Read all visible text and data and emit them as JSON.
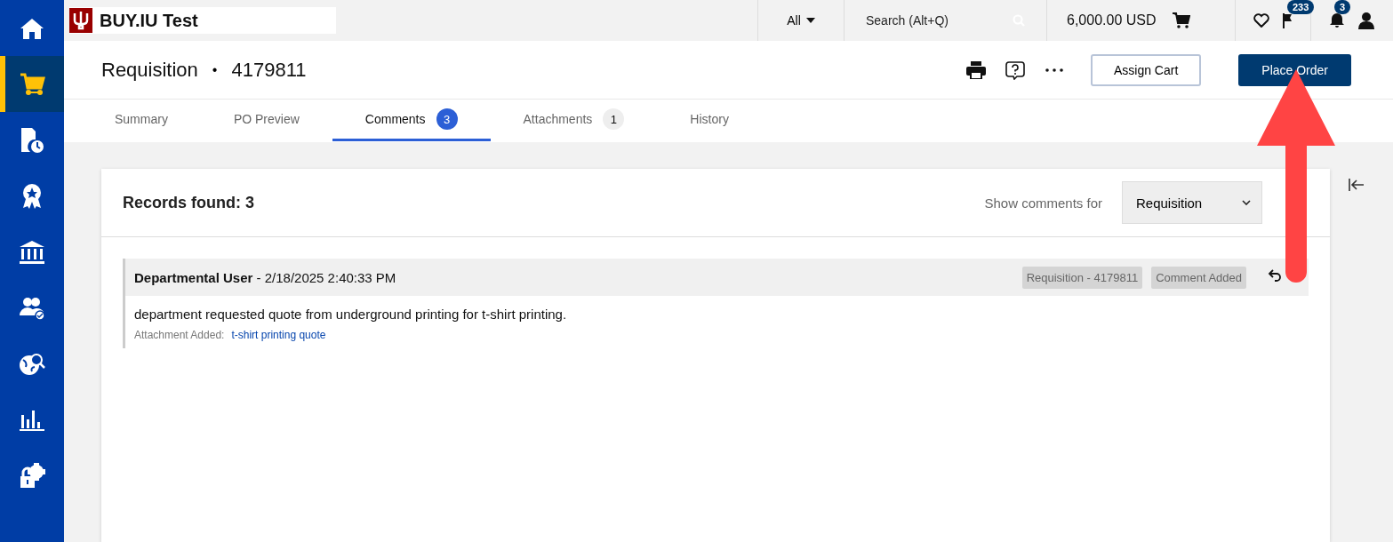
{
  "sidebar": {
    "items": [
      {
        "kind": "home",
        "selected": false
      },
      {
        "kind": "cart",
        "selected": true
      },
      {
        "kind": "document",
        "selected": false
      },
      {
        "kind": "award",
        "selected": false
      },
      {
        "kind": "bank",
        "selected": false
      },
      {
        "kind": "people",
        "selected": false
      },
      {
        "kind": "globe",
        "selected": false
      },
      {
        "kind": "chart",
        "selected": false
      },
      {
        "kind": "lock",
        "selected": false
      }
    ]
  },
  "top_bar": {
    "logo_text": "BUY.IU Test",
    "scope": "All",
    "search": {
      "placeholder": "Search (Alt+Q)"
    },
    "cart_total": "6,000.00 USD",
    "flag_count": "233",
    "notification_count": "3"
  },
  "header": {
    "title": "Requisition",
    "separator": "•",
    "number": "4179811",
    "buttons": [
      "Assign Cart",
      "Place Order"
    ]
  },
  "tabs": [
    {
      "label": "Summary",
      "selected": false
    },
    {
      "label": "PO Preview",
      "selected": false
    },
    {
      "label": "Comments",
      "count": "3",
      "selected": true
    },
    {
      "label": "Attachments",
      "count": "1",
      "selected": false
    },
    {
      "label": "History",
      "selected": false
    }
  ],
  "comments_panel": {
    "records_found": "Records found: 3",
    "filter_label": "Show comments for",
    "filter_value": "Requisition",
    "comments": [
      {
        "author": "Departmental User",
        "date": " - 2/18/2025 2:40:33 PM",
        "tags": [
          "Requisition - 4179811",
          "Comment Added"
        ],
        "text": "department requested quote from underground printing for t-shirt printing.",
        "attachment_label": "Attachment Added:",
        "attachment_link": "t-shirt printing quote"
      }
    ]
  }
}
